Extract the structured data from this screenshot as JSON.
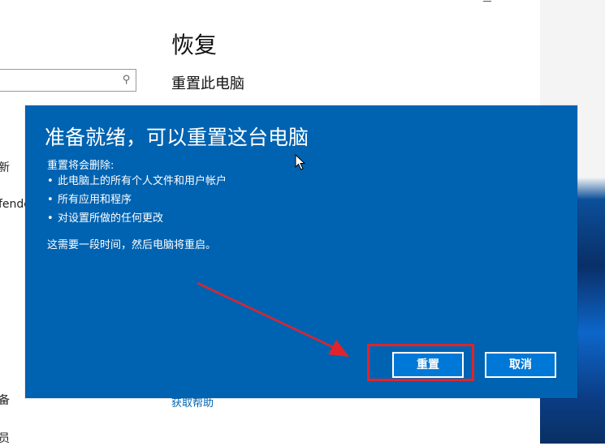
{
  "settings": {
    "page_title": "恢复",
    "section_heading": "重置此电脑",
    "get_help_link": "获取帮助",
    "sidebar": {
      "item1": "新",
      "item2": "fende",
      "item3": "备",
      "item4": "员"
    }
  },
  "dialog": {
    "title": "准备就绪，可以重置这台电脑",
    "remove_heading": "重置将会删除:",
    "remove_items": [
      "此电脑上的所有个人文件和用户帐户",
      "所有应用和程序",
      "对设置所做的任何更改"
    ],
    "bullet": "•",
    "time_note": "这需要一段时间，然后电脑将重启。",
    "reset_label": "重置",
    "cancel_label": "取消"
  },
  "colors": {
    "dialog_background": "#0063b1",
    "button_background": "#0078d7",
    "annotation_red": "#e0242b"
  },
  "icons": {
    "search": "search-icon",
    "cursor": "mouse-cursor-icon",
    "arrow": "annotation-arrow"
  }
}
